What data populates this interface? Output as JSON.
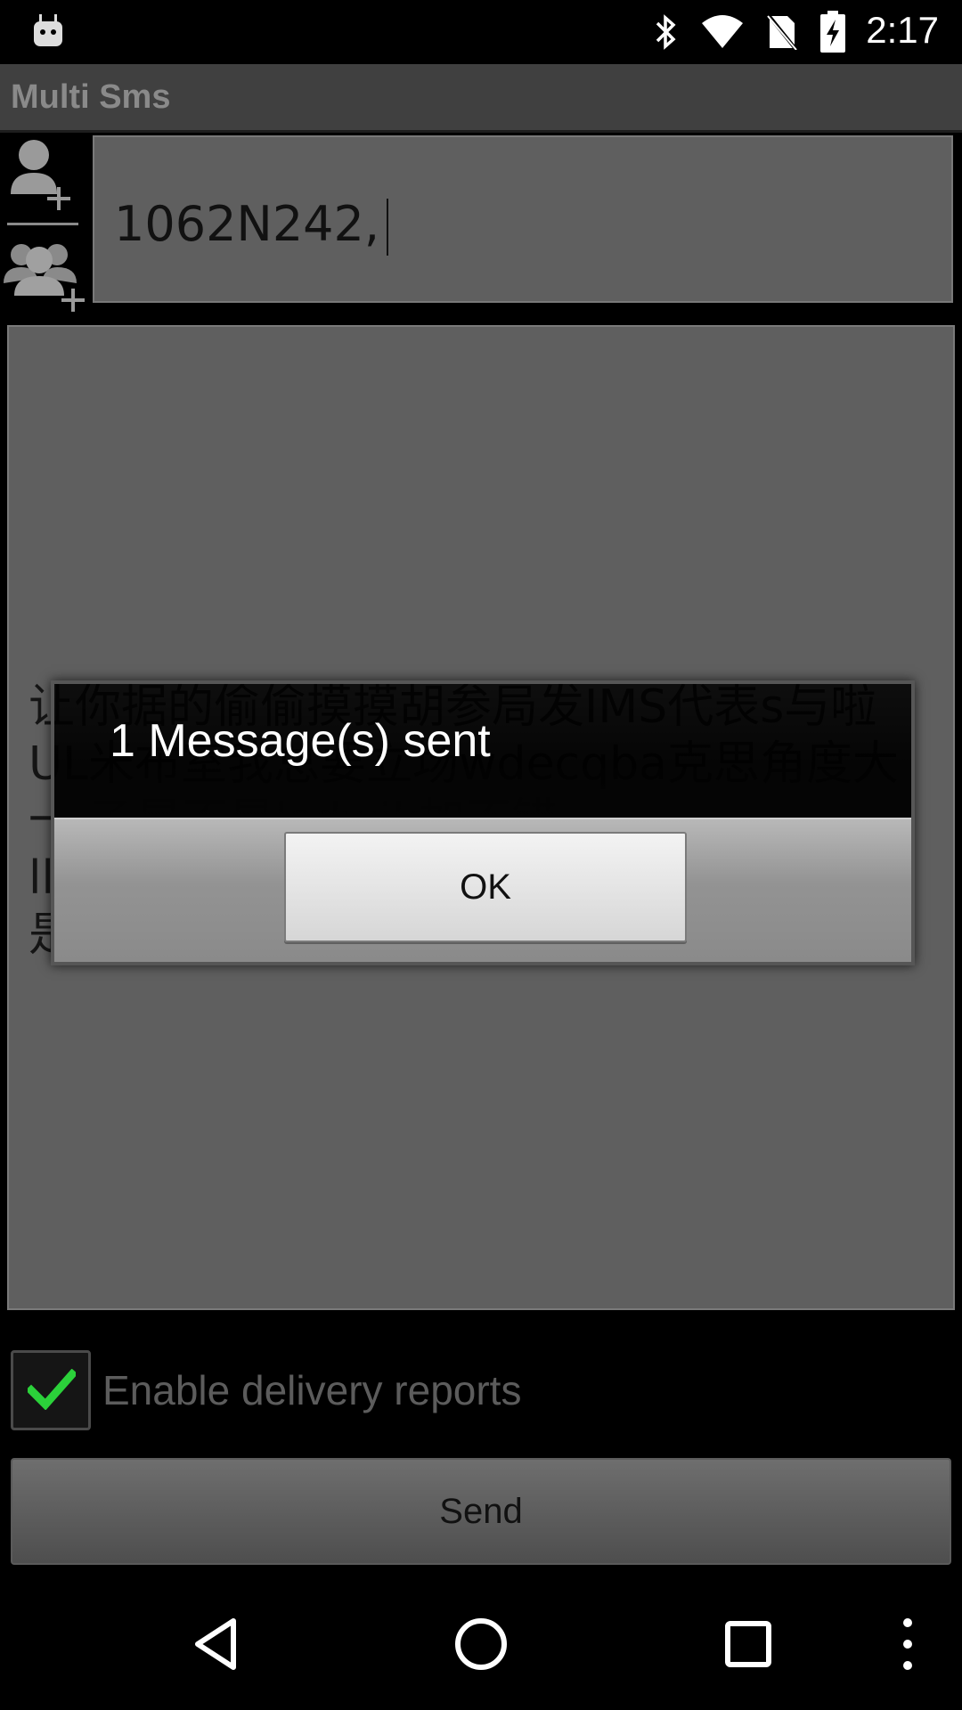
{
  "status_bar": {
    "time": "2:17",
    "icons": [
      "android-notification-icon",
      "bluetooth-icon",
      "wifi-icon",
      "no-sim-icon",
      "battery-charging-icon"
    ]
  },
  "app": {
    "title": "Multi Sms"
  },
  "recipients": {
    "value": "1062N242,",
    "add_contact_icon": "add-contact-icon",
    "add_group_icon": "add-group-icon"
  },
  "message": {
    "text": "让你据的偷偷摸摸胡参局发IMS代表s与啦\nUL米布室我总要立场wdecqba克思角度大\n一 乙是不是lsdwik加不错\nll\n是"
  },
  "delivery_reports": {
    "label": "Enable delivery reports",
    "checked": true
  },
  "send_button": {
    "label": "Send"
  },
  "dialog": {
    "message": "1 Message(s) sent",
    "ok_label": "OK"
  },
  "nav_bar": {
    "items": [
      "back-icon",
      "home-icon",
      "recents-icon",
      "overflow-menu-icon"
    ]
  },
  "colors": {
    "title_text": "#8a8a8a",
    "panel_bg": "#5f5f5f",
    "check_green": "#2bd13a"
  }
}
